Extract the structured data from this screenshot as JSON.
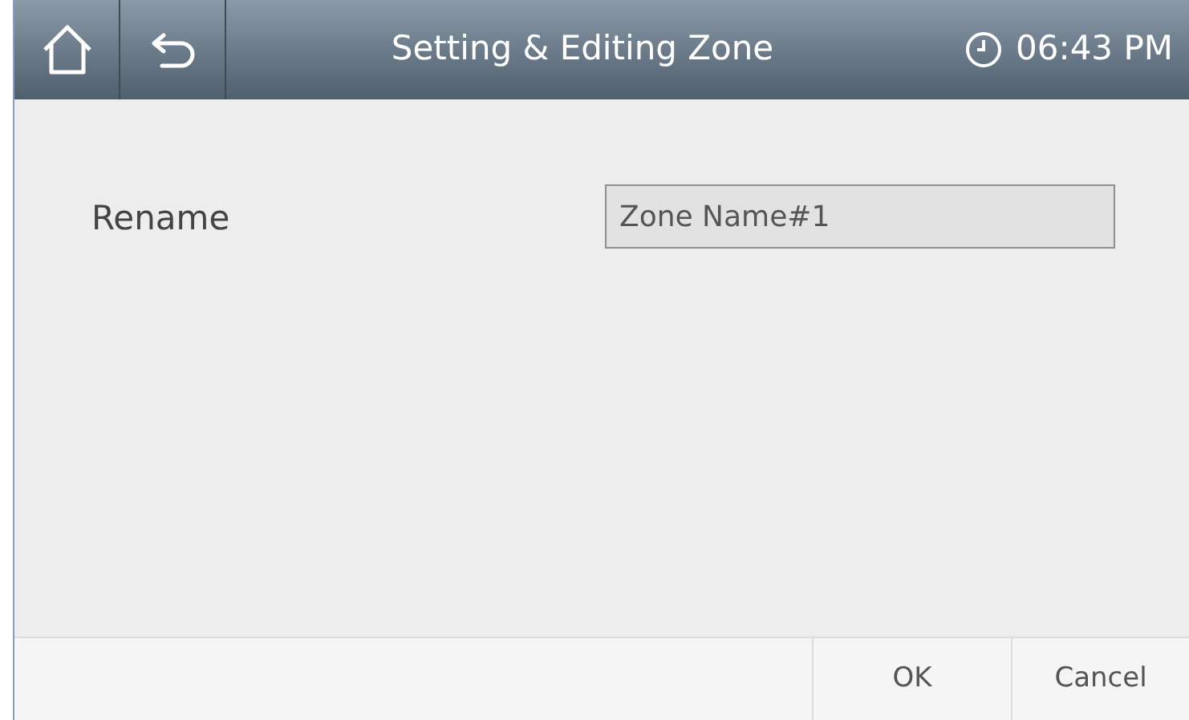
{
  "header": {
    "title": "Setting & Editing Zone",
    "time": "06:43 PM"
  },
  "form": {
    "label": "Rename",
    "value": "Zone Name#1"
  },
  "buttons": [
    "OK",
    "Cancel"
  ]
}
